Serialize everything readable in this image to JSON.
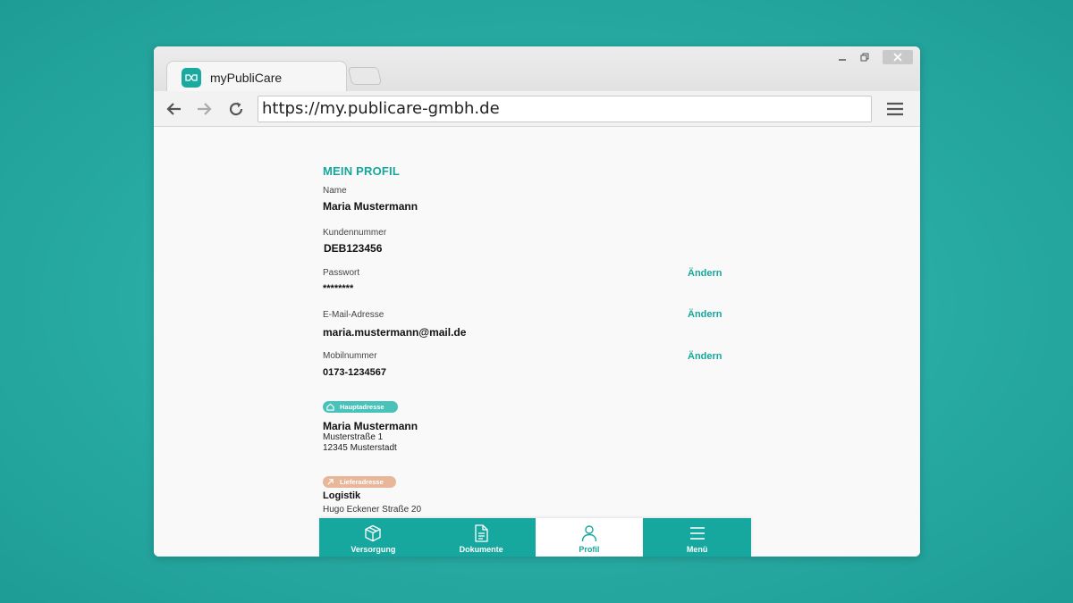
{
  "browser": {
    "tab_title": "myPubliCare",
    "url": "https://my.publicare-gmbh.de"
  },
  "colors": {
    "accent": "#15a79c",
    "main_address_badge": "#49c3ba",
    "delivery_address_badge": "#e8b79a",
    "background": "#2aaea6"
  },
  "profile": {
    "heading": "MEIN PROFIL",
    "change_label": "Ändern",
    "fields": {
      "name": {
        "label": "Name",
        "value": "Maria Mustermann"
      },
      "customer_number": {
        "label": "Kundennummer",
        "value": "DEB123456"
      },
      "password": {
        "label": "Passwort",
        "value": "********"
      },
      "email": {
        "label": "E-Mail-Adresse",
        "value": "maria.mustermann@mail.de"
      },
      "mobile": {
        "label": "Mobilnummer",
        "value": "0173-1234567"
      }
    },
    "main_address": {
      "badge": "Hauptadresse",
      "name": "Maria Mustermann",
      "street": "Musterstraße 1",
      "city": "12345 Musterstadt"
    },
    "delivery_address": {
      "badge": "Lieferadresse",
      "name": "Logistik",
      "street": "Hugo Eckener Straße 20"
    }
  },
  "bottom_nav": {
    "items": [
      {
        "label": "Versorgung",
        "icon": "box-icon"
      },
      {
        "label": "Dokumente",
        "icon": "document-icon"
      },
      {
        "label": "Profil",
        "icon": "person-icon",
        "active": true
      },
      {
        "label": "Menü",
        "icon": "hamburger-icon"
      }
    ]
  }
}
